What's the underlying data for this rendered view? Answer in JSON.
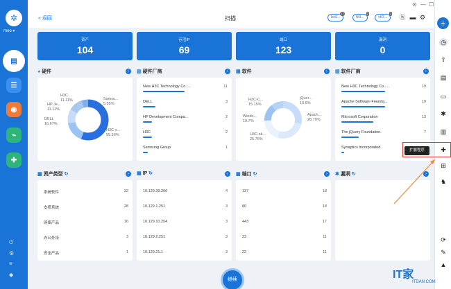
{
  "sidebar": {
    "user": "moo ▾"
  },
  "topbar": {
    "back": "« 返回",
    "title": "扫描",
    "pills": [
      {
        "label": "boE..",
        "count": "17"
      },
      {
        "label": "fk9...",
        "count": "2"
      },
      {
        "label": "vtO...",
        "count": "1"
      }
    ]
  },
  "stats": [
    {
      "label": "资产",
      "value": "104"
    },
    {
      "label": "存活IP",
      "value": "69"
    },
    {
      "label": "端口",
      "value": "123"
    },
    {
      "label": "漏洞",
      "value": "0"
    }
  ],
  "hardware": {
    "title": "硬件",
    "labels": [
      {
        "name": "H3C",
        "pct": "11.11%"
      },
      {
        "name": "HP Je...",
        "pct": "11.11%"
      },
      {
        "name": "DELL",
        "pct": "16.67%"
      },
      {
        "name": "Samsu...",
        "pct": "5.55%"
      },
      {
        "name": "H3C-s...",
        "pct": "55.56%"
      }
    ]
  },
  "hwvendor": {
    "title": "硬件厂商",
    "items": [
      {
        "name": "New H3C Technology Co.....",
        "count": "11",
        "frac": 0.85
      },
      {
        "name": "DELL",
        "count": "3",
        "frac": 0.25
      },
      {
        "name": "HP Development Compa...",
        "count": "2",
        "frac": 0.18
      },
      {
        "name": "H3C",
        "count": "2",
        "frac": 0.18
      },
      {
        "name": "Samsung Group",
        "count": "1",
        "frac": 0.1
      }
    ]
  },
  "software": {
    "title": "软件",
    "labels": [
      {
        "name": "H3C-C...",
        "pct": "15.15%"
      },
      {
        "name": "Windo...",
        "pct": "19.7%"
      },
      {
        "name": "H3C-sk...",
        "pct": "25.76%"
      },
      {
        "name": "jQuer...",
        "pct": "10.6%"
      },
      {
        "name": "Apach...",
        "pct": "28.79%"
      }
    ]
  },
  "swvendor": {
    "title": "软件厂商",
    "items": [
      {
        "name": "New H3C Technology Co.....",
        "count": "19",
        "frac": 0.9
      },
      {
        "name": "Apache Software Founda...",
        "count": "19",
        "frac": 0.9
      },
      {
        "name": "Microsoft Corporation",
        "count": "13",
        "frac": 0.65
      },
      {
        "name": "The jQuery Foundation.",
        "count": "7",
        "frac": 0.35
      },
      {
        "name": "Synaptics Incorporated.",
        "count": "",
        "frac": 0.05
      }
    ]
  },
  "assettype": {
    "title": "资产类型",
    "rows": [
      {
        "name": "系统软件",
        "count": "32"
      },
      {
        "name": "支撑系统",
        "count": "28"
      },
      {
        "name": "网络产品",
        "count": "16"
      },
      {
        "name": "办公外设",
        "count": "3"
      },
      {
        "name": "安全产品",
        "count": "1"
      }
    ]
  },
  "ip": {
    "title": "IP",
    "rows": [
      {
        "name": "10.129.39.200",
        "count": "4"
      },
      {
        "name": "10.129.1.251",
        "count": "3"
      },
      {
        "name": "10.129.10.254",
        "count": "3"
      },
      {
        "name": "10.129.2.251",
        "count": "3"
      },
      {
        "name": "10.129.21.1",
        "count": "3"
      }
    ]
  },
  "port": {
    "title": "端口",
    "rows": [
      {
        "name": "137",
        "count": "18"
      },
      {
        "name": "80",
        "count": "18"
      },
      {
        "name": "443",
        "count": "17"
      },
      {
        "name": "23",
        "count": "11"
      },
      {
        "name": "22",
        "count": "11"
      }
    ]
  },
  "vuln": {
    "title": "漏洞"
  },
  "tooltip": "扩展程序",
  "continue": "继续",
  "watermark": {
    "main": "IT家",
    "sub": "ITDAN.COM"
  },
  "colors": {
    "primary": "#1a73d6",
    "highlight": "#e03a2e"
  }
}
